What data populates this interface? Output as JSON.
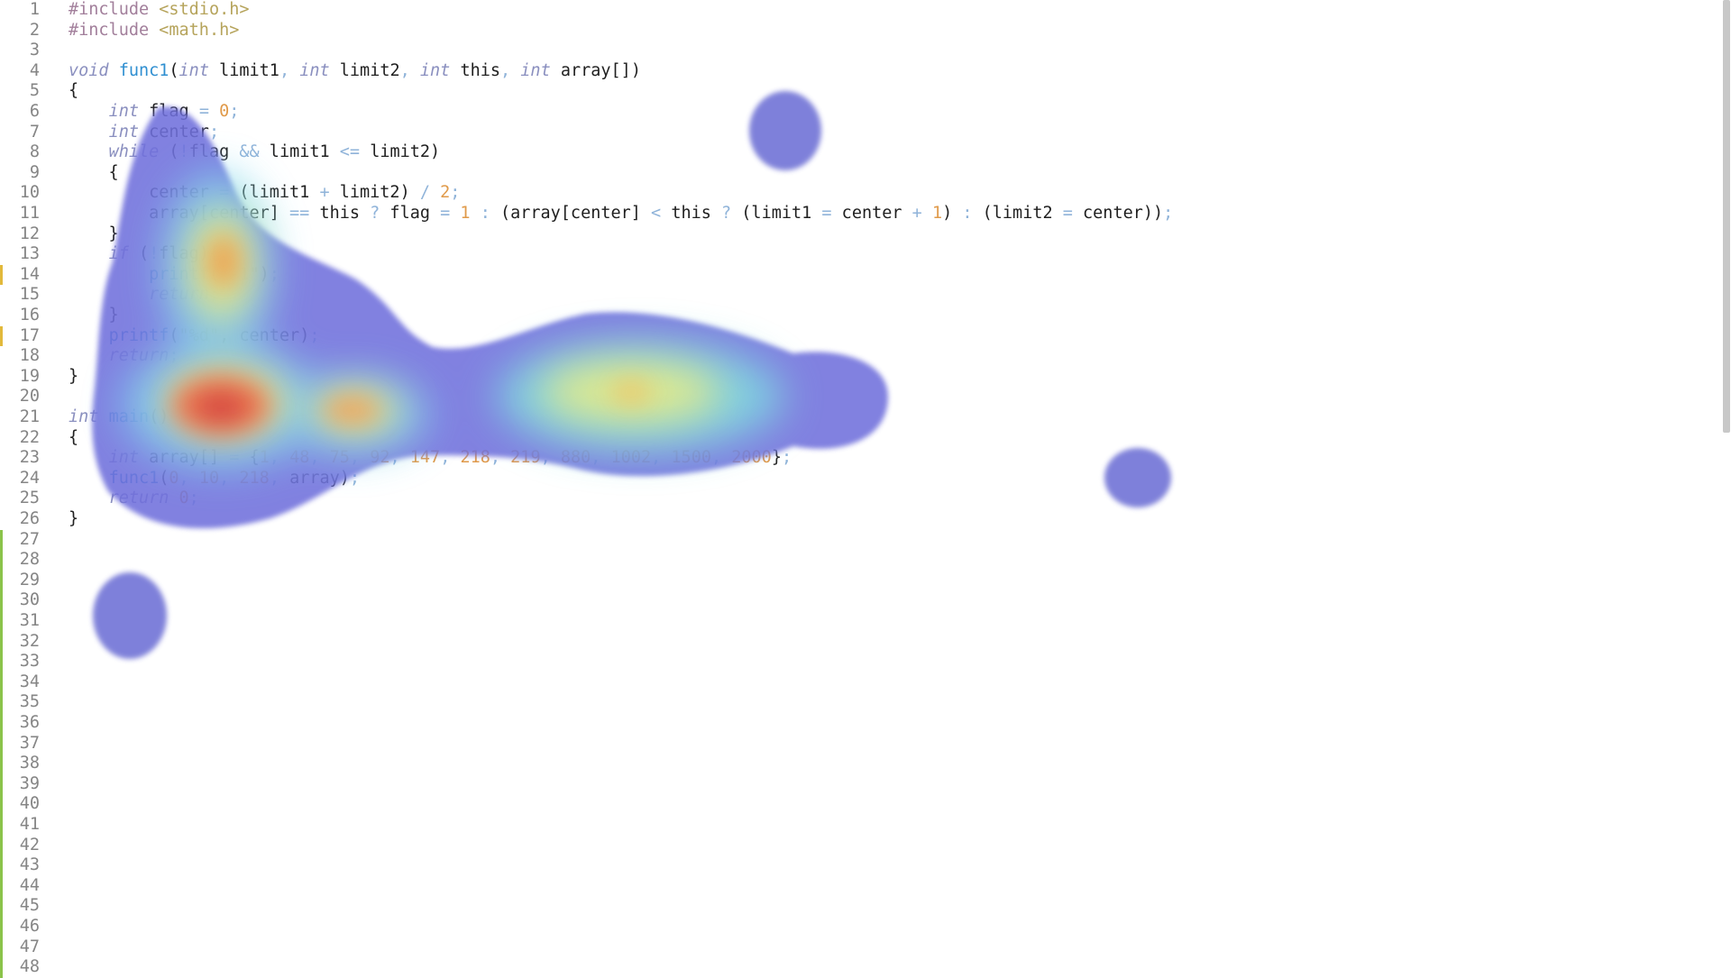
{
  "editor": {
    "lines": [
      {
        "n": "1",
        "tokens": [
          {
            "t": "#include ",
            "c": "pre"
          },
          {
            "t": "<stdio.h>",
            "c": "str"
          }
        ]
      },
      {
        "n": "2",
        "tokens": [
          {
            "t": "#include ",
            "c": "pre"
          },
          {
            "t": "<math.h>",
            "c": "str"
          }
        ]
      },
      {
        "n": "3",
        "tokens": []
      },
      {
        "n": "4",
        "tokens": [
          {
            "t": "void",
            "c": "kw"
          },
          {
            "t": " "
          },
          {
            "t": "func1",
            "c": "fn"
          },
          {
            "t": "("
          },
          {
            "t": "int",
            "c": "kw"
          },
          {
            "t": " limit1"
          },
          {
            "t": ", ",
            "c": "op"
          },
          {
            "t": "int",
            "c": "kw"
          },
          {
            "t": " limit2"
          },
          {
            "t": ", ",
            "c": "op"
          },
          {
            "t": "int",
            "c": "kw"
          },
          {
            "t": " this"
          },
          {
            "t": ", ",
            "c": "op"
          },
          {
            "t": "int",
            "c": "kw"
          },
          {
            "t": " array[])"
          }
        ]
      },
      {
        "n": "5",
        "tokens": [
          {
            "t": "{"
          }
        ]
      },
      {
        "n": "6",
        "tokens": [
          {
            "t": "    "
          },
          {
            "t": "int",
            "c": "kw"
          },
          {
            "t": " flag "
          },
          {
            "t": "=",
            "c": "op"
          },
          {
            "t": " "
          },
          {
            "t": "0",
            "c": "num"
          },
          {
            "t": ";",
            "c": "op"
          }
        ]
      },
      {
        "n": "7",
        "tokens": [
          {
            "t": "    "
          },
          {
            "t": "int",
            "c": "kw"
          },
          {
            "t": " center"
          },
          {
            "t": ";",
            "c": "op"
          }
        ]
      },
      {
        "n": "8",
        "tokens": [
          {
            "t": "    "
          },
          {
            "t": "while",
            "c": "kw"
          },
          {
            "t": " ("
          },
          {
            "t": "!",
            "c": "op"
          },
          {
            "t": "flag "
          },
          {
            "t": "&&",
            "c": "op"
          },
          {
            "t": " limit1 "
          },
          {
            "t": "<=",
            "c": "op"
          },
          {
            "t": " limit2)"
          }
        ]
      },
      {
        "n": "9",
        "tokens": [
          {
            "t": "    {"
          }
        ]
      },
      {
        "n": "10",
        "tokens": [
          {
            "t": "        center "
          },
          {
            "t": "=",
            "c": "op"
          },
          {
            "t": " (limit1 "
          },
          {
            "t": "+",
            "c": "op"
          },
          {
            "t": " limit2) "
          },
          {
            "t": "/",
            "c": "op"
          },
          {
            "t": " "
          },
          {
            "t": "2",
            "c": "num"
          },
          {
            "t": ";",
            "c": "op"
          }
        ]
      },
      {
        "n": "11",
        "tokens": [
          {
            "t": "        array[center] "
          },
          {
            "t": "==",
            "c": "op"
          },
          {
            "t": " this "
          },
          {
            "t": "?",
            "c": "op"
          },
          {
            "t": " flag "
          },
          {
            "t": "=",
            "c": "op"
          },
          {
            "t": " "
          },
          {
            "t": "1",
            "c": "num"
          },
          {
            "t": " "
          },
          {
            "t": ":",
            "c": "op"
          },
          {
            "t": " (array[center] "
          },
          {
            "t": "<",
            "c": "op"
          },
          {
            "t": " this "
          },
          {
            "t": "?",
            "c": "op"
          },
          {
            "t": " (limit1 "
          },
          {
            "t": "=",
            "c": "op"
          },
          {
            "t": " center "
          },
          {
            "t": "+",
            "c": "op"
          },
          {
            "t": " "
          },
          {
            "t": "1",
            "c": "num"
          },
          {
            "t": ") "
          },
          {
            "t": ":",
            "c": "op"
          },
          {
            "t": " (limit2 "
          },
          {
            "t": "=",
            "c": "op"
          },
          {
            "t": " center))"
          },
          {
            "t": ";",
            "c": "op"
          }
        ]
      },
      {
        "n": "12",
        "tokens": [
          {
            "t": "    }"
          }
        ]
      },
      {
        "n": "13",
        "tokens": [
          {
            "t": "    "
          },
          {
            "t": "if",
            "c": "kw"
          },
          {
            "t": " ("
          },
          {
            "t": "!",
            "c": "op"
          },
          {
            "t": "flag){"
          }
        ]
      },
      {
        "n": "14",
        "tokens": [
          {
            "t": "        "
          },
          {
            "t": "printf",
            "c": "fn"
          },
          {
            "t": "("
          },
          {
            "t": "\"-1\"",
            "c": "str"
          },
          {
            "t": ")"
          },
          {
            "t": ";",
            "c": "op"
          }
        ]
      },
      {
        "n": "15",
        "tokens": [
          {
            "t": "        "
          },
          {
            "t": "return",
            "c": "kw"
          },
          {
            "t": ";",
            "c": "op"
          }
        ]
      },
      {
        "n": "16",
        "tokens": [
          {
            "t": "    }"
          }
        ]
      },
      {
        "n": "17",
        "tokens": [
          {
            "t": "    "
          },
          {
            "t": "printf",
            "c": "fn"
          },
          {
            "t": "("
          },
          {
            "t": "\"%d\"",
            "c": "str"
          },
          {
            "t": ", center)"
          },
          {
            "t": ";",
            "c": "op"
          }
        ]
      },
      {
        "n": "18",
        "tokens": [
          {
            "t": "    "
          },
          {
            "t": "return",
            "c": "kw"
          },
          {
            "t": ";",
            "c": "op"
          }
        ]
      },
      {
        "n": "19",
        "tokens": [
          {
            "t": "}"
          }
        ]
      },
      {
        "n": "20",
        "tokens": []
      },
      {
        "n": "21",
        "tokens": [
          {
            "t": "int",
            "c": "kw"
          },
          {
            "t": " "
          },
          {
            "t": "main",
            "c": "fn"
          },
          {
            "t": "()"
          }
        ]
      },
      {
        "n": "22",
        "tokens": [
          {
            "t": "{"
          }
        ]
      },
      {
        "n": "23",
        "tokens": [
          {
            "t": "    "
          },
          {
            "t": "int",
            "c": "kw"
          },
          {
            "t": " array[] "
          },
          {
            "t": "=",
            "c": "op"
          },
          {
            "t": " {"
          },
          {
            "t": "1",
            "c": "num"
          },
          {
            "t": ", ",
            "c": "op"
          },
          {
            "t": "48",
            "c": "num"
          },
          {
            "t": ", ",
            "c": "op"
          },
          {
            "t": "75",
            "c": "num"
          },
          {
            "t": ", ",
            "c": "op"
          },
          {
            "t": "92",
            "c": "num"
          },
          {
            "t": ", ",
            "c": "op"
          },
          {
            "t": "147",
            "c": "num"
          },
          {
            "t": ", ",
            "c": "op"
          },
          {
            "t": "218",
            "c": "num"
          },
          {
            "t": ", ",
            "c": "op"
          },
          {
            "t": "219",
            "c": "num"
          },
          {
            "t": ", ",
            "c": "op"
          },
          {
            "t": "880",
            "c": "num"
          },
          {
            "t": ", ",
            "c": "op"
          },
          {
            "t": "1002",
            "c": "num"
          },
          {
            "t": ", ",
            "c": "op"
          },
          {
            "t": "1500",
            "c": "num"
          },
          {
            "t": ", ",
            "c": "op"
          },
          {
            "t": "2000",
            "c": "num"
          },
          {
            "t": "}"
          },
          {
            "t": ";",
            "c": "op"
          }
        ]
      },
      {
        "n": "24",
        "tokens": [
          {
            "t": "    "
          },
          {
            "t": "func1",
            "c": "fn"
          },
          {
            "t": "("
          },
          {
            "t": "0",
            "c": "num"
          },
          {
            "t": ", ",
            "c": "op"
          },
          {
            "t": "10",
            "c": "num"
          },
          {
            "t": ", ",
            "c": "op"
          },
          {
            "t": "218",
            "c": "num"
          },
          {
            "t": ", ",
            "c": "op"
          },
          {
            "t": "array)"
          },
          {
            "t": ";",
            "c": "op"
          }
        ]
      },
      {
        "n": "25",
        "tokens": [
          {
            "t": "    "
          },
          {
            "t": "return",
            "c": "kw"
          },
          {
            "t": " "
          },
          {
            "t": "0",
            "c": "num"
          },
          {
            "t": ";",
            "c": "op"
          }
        ]
      },
      {
        "n": "26",
        "tokens": [
          {
            "t": "}"
          }
        ]
      },
      {
        "n": "27",
        "tokens": []
      },
      {
        "n": "28",
        "tokens": []
      },
      {
        "n": "29",
        "tokens": []
      },
      {
        "n": "30",
        "tokens": []
      },
      {
        "n": "31",
        "tokens": []
      },
      {
        "n": "32",
        "tokens": []
      },
      {
        "n": "33",
        "tokens": []
      },
      {
        "n": "34",
        "tokens": []
      },
      {
        "n": "35",
        "tokens": []
      },
      {
        "n": "36",
        "tokens": []
      },
      {
        "n": "37",
        "tokens": []
      },
      {
        "n": "38",
        "tokens": []
      },
      {
        "n": "39",
        "tokens": []
      },
      {
        "n": "40",
        "tokens": []
      },
      {
        "n": "41",
        "tokens": []
      },
      {
        "n": "42",
        "tokens": []
      },
      {
        "n": "43",
        "tokens": []
      },
      {
        "n": "44",
        "tokens": []
      },
      {
        "n": "45",
        "tokens": []
      },
      {
        "n": "46",
        "tokens": []
      },
      {
        "n": "47",
        "tokens": []
      },
      {
        "n": "48",
        "tokens": []
      }
    ],
    "gutter_markers": {
      "modified_lines": [
        "14",
        "17"
      ],
      "added_from_line": "27",
      "added_to_line": "48"
    }
  },
  "colors": {
    "modified_marker": "#e2b93b",
    "added_marker": "#8bc34a",
    "heat_low": "#6f6fd8",
    "heat_mid": "#7fe0e0",
    "heat_high": "#f0f070",
    "heat_peak": "#e03030"
  }
}
